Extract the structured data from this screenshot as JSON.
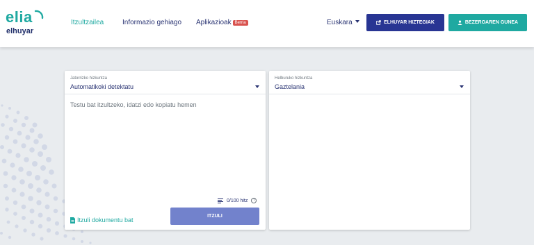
{
  "logo": {
    "primary": "elia",
    "secondary": "elhuyar"
  },
  "nav": {
    "translator": "Itzultzailea",
    "more_info": "Informazio gehiago",
    "apps": "Aplikazioak",
    "apps_badge": "Berria"
  },
  "language": {
    "current": "Euskara"
  },
  "buttons": {
    "dictionaries": "ELHUYAR HIZTEGIAK",
    "user_area": "BEZEROAREN GUNEA",
    "translate": "ITZULI"
  },
  "source": {
    "label": "Jatorrizko hizkuntza",
    "value": "Automatikoki detektatu",
    "placeholder": "Testu bat itzultzeko, idatzi edo kopiatu hemen",
    "counter": "0/100 hitz",
    "document_link": "Itzuli dokumentu bat"
  },
  "target": {
    "label": "Helburuko hizkuntza",
    "value": "Gaztelania"
  },
  "colors": {
    "brand_teal": "#1fa9a1",
    "brand_navy": "#283593",
    "translate_button": "#7282cc"
  },
  "icons": {
    "dictionaries": "external-link-icon",
    "user_area": "user-icon",
    "counter": "text-lines-icon",
    "help": "question-circle-icon",
    "document": "document-icon"
  }
}
